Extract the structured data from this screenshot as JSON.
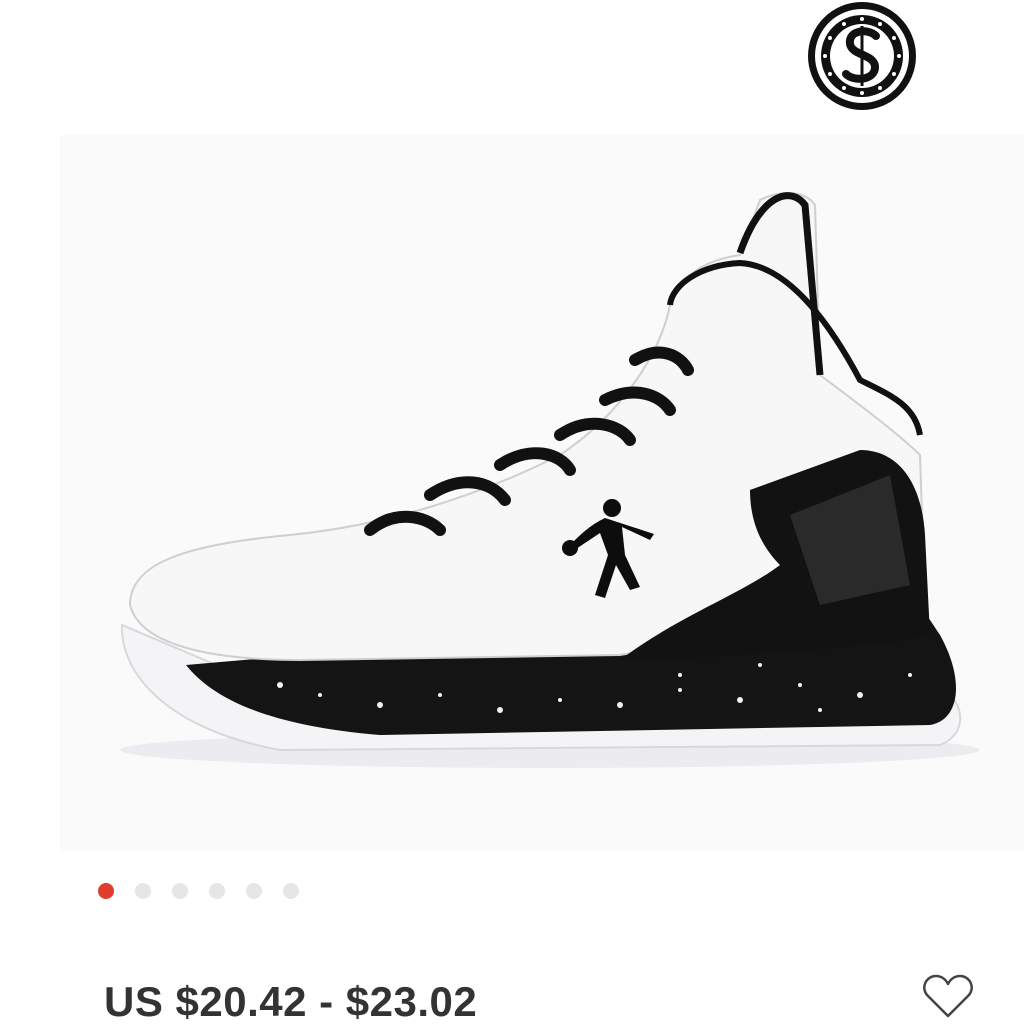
{
  "brand": {
    "logo_icon": "brand-s-logo-icon",
    "logo_letter": "S"
  },
  "gallery": {
    "image_icon": "basketball-sneaker-image",
    "image_count": 6,
    "active_index": 0,
    "colors": {
      "active": "#e23c2f",
      "inactive": "#e6e6e9"
    }
  },
  "product": {
    "price_range": "US $20.42 - $23.02"
  },
  "wishlist": {
    "icon": "heart-outline-icon"
  }
}
